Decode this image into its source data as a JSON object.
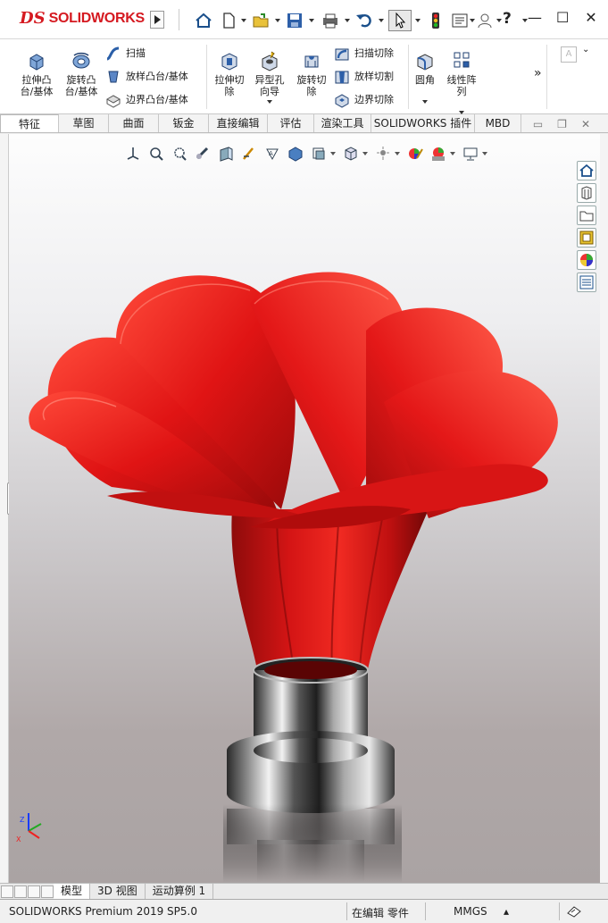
{
  "app": {
    "brand_prefix": "DS",
    "brand_name": "SOLIDWORKS"
  },
  "command_manager": {
    "extrude_boss": "拉伸凸\n台/基体",
    "revolve_boss": "旋转凸\n台/基体",
    "sweep": "扫描",
    "loft_boss": "放样凸台/基体",
    "boundary_boss": "边界凸台/基体",
    "extrude_cut": "拉伸切\n除",
    "hole_wizard": "异型孔\n向导",
    "revolve_cut": "旋转切\n除",
    "sweep_cut": "扫描切除",
    "loft_cut": "放样切割",
    "boundary_cut": "边界切除",
    "fillet": "圆角",
    "linear_pattern": "线性阵\n列",
    "more": "»"
  },
  "tabs": [
    {
      "label": "特征",
      "active": true
    },
    {
      "label": "草图"
    },
    {
      "label": "曲面"
    },
    {
      "label": "钣金"
    },
    {
      "label": "直接编辑"
    },
    {
      "label": "评估"
    },
    {
      "label": "渲染工具"
    },
    {
      "label": "SOLIDWORKS 插件"
    },
    {
      "label": "MBD"
    }
  ],
  "bottom_tabs": [
    {
      "label": "模型",
      "active": true
    },
    {
      "label": "3D 视图"
    },
    {
      "label": "运动算例 1"
    }
  ],
  "status": {
    "product": "SOLIDWORKS Premium 2019 SP5.0",
    "mode": "在编辑 零件",
    "units": "MMGS",
    "units_arrow": "▴"
  },
  "window_controls": {
    "minimize": "—",
    "maximize": "☐",
    "close": "✕"
  },
  "doc_controls": {
    "minimize": "▭",
    "restore": "❐",
    "close": "✕"
  },
  "colors": {
    "brand": "#d51920",
    "petal": "#e01a1a",
    "chrome": "#9a9a9a"
  }
}
